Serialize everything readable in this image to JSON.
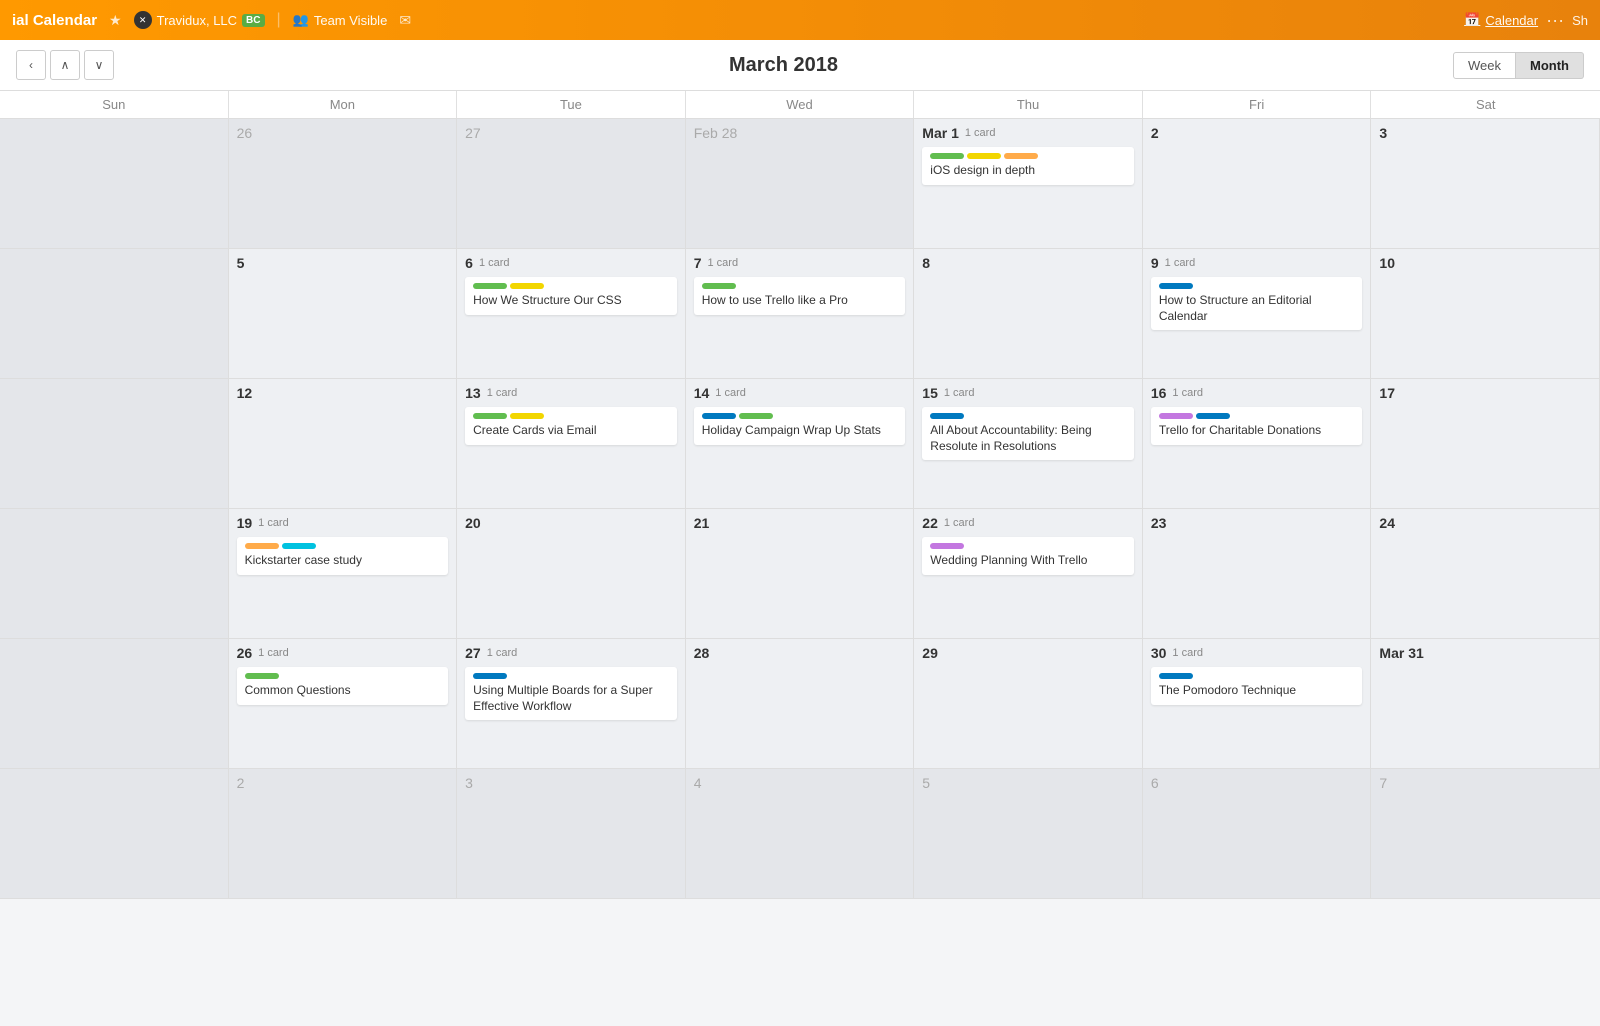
{
  "navbar": {
    "title": "ial Calendar",
    "star": "★",
    "org_name": "Travidux, LLC",
    "org_badge": "BC",
    "team": "Team Visible",
    "calendar_link": "Calendar",
    "dots": "···",
    "sh": "Sh"
  },
  "toolbar": {
    "title": "March 2018",
    "week_label": "Week",
    "month_label": "Month",
    "prev_label": "‹",
    "up_label": "∧",
    "down_label": "∨"
  },
  "days_of_week": [
    "Sun",
    "Mon",
    "Tue",
    "Wed",
    "Thu",
    "Fri",
    "Sat"
  ],
  "weeks": [
    {
      "days": [
        {
          "num": "",
          "label": "",
          "muted": true,
          "out": true
        },
        {
          "num": "26",
          "label": "26",
          "muted": true,
          "out": true,
          "cards": []
        },
        {
          "num": "27",
          "label": "27",
          "muted": true,
          "out": true,
          "cards": []
        },
        {
          "num": "Feb 28",
          "label": "Feb 28",
          "muted": true,
          "out": true,
          "cards": []
        },
        {
          "num": "Mar 1",
          "label": "Mar 1",
          "card_count": "1 card",
          "cards": [
            {
              "labels": [
                "green",
                "yellow",
                "orange"
              ],
              "title": "iOS design in depth"
            }
          ]
        },
        {
          "num": "2",
          "label": "2",
          "cards": []
        },
        {
          "num": "3",
          "label": "3",
          "cards": []
        }
      ]
    },
    {
      "days": [
        {
          "num": "",
          "label": "",
          "muted": true,
          "out": true,
          "cards": []
        },
        {
          "num": "5",
          "label": "5",
          "cards": []
        },
        {
          "num": "6",
          "label": "6",
          "card_count": "1 card",
          "cards": [
            {
              "labels": [
                "green",
                "yellow"
              ],
              "title": "How We Structure Our CSS"
            }
          ]
        },
        {
          "num": "7",
          "label": "7",
          "card_count": "1 card",
          "cards": [
            {
              "labels": [
                "green"
              ],
              "title": "How to use Trello like a Pro"
            }
          ]
        },
        {
          "num": "8",
          "label": "8",
          "cards": []
        },
        {
          "num": "9",
          "label": "9",
          "card_count": "1 card",
          "cards": [
            {
              "labels": [
                "blue"
              ],
              "title": "How to Structure an Editorial Calendar"
            }
          ]
        },
        {
          "num": "10",
          "label": "10",
          "cards": []
        }
      ]
    },
    {
      "days": [
        {
          "num": "",
          "label": "",
          "muted": true,
          "out": true,
          "cards": []
        },
        {
          "num": "12",
          "label": "12",
          "cards": []
        },
        {
          "num": "13",
          "label": "13",
          "card_count": "1 card",
          "cards": [
            {
              "labels": [
                "green",
                "yellow"
              ],
              "title": "Create Cards via Email"
            }
          ]
        },
        {
          "num": "14",
          "label": "14",
          "card_count": "1 card",
          "cards": [
            {
              "labels": [
                "blue",
                "green"
              ],
              "title": "Holiday Campaign Wrap Up Stats"
            }
          ]
        },
        {
          "num": "15",
          "label": "15",
          "card_count": "1 card",
          "cards": [
            {
              "labels": [
                "blue"
              ],
              "title": "All About Accountability: Being Resolute in Resolutions"
            }
          ]
        },
        {
          "num": "16",
          "label": "16",
          "card_count": "1 card",
          "cards": [
            {
              "labels": [
                "purple",
                "blue"
              ],
              "title": "Trello for Charitable Donations"
            }
          ]
        },
        {
          "num": "17",
          "label": "17",
          "cards": []
        }
      ]
    },
    {
      "days": [
        {
          "num": "",
          "label": "",
          "muted": true,
          "out": true,
          "cards": []
        },
        {
          "num": "19",
          "label": "19",
          "card_count": "1 card",
          "cards": [
            {
              "labels": [
                "orange",
                "cyan"
              ],
              "title": "Kickstarter case study"
            }
          ]
        },
        {
          "num": "20",
          "label": "20",
          "cards": []
        },
        {
          "num": "21",
          "label": "21",
          "cards": []
        },
        {
          "num": "22",
          "label": "22",
          "card_count": "1 card",
          "cards": [
            {
              "labels": [
                "purple"
              ],
              "title": "Wedding Planning With Trello"
            }
          ]
        },
        {
          "num": "23",
          "label": "23",
          "cards": []
        },
        {
          "num": "24",
          "label": "24",
          "cards": []
        }
      ]
    },
    {
      "days": [
        {
          "num": "",
          "label": "",
          "muted": true,
          "out": true,
          "cards": []
        },
        {
          "num": "26",
          "label": "26",
          "card_count": "1 card",
          "cards": [
            {
              "labels": [
                "green"
              ],
              "title": "Common Questions"
            }
          ]
        },
        {
          "num": "27",
          "label": "27",
          "card_count": "1 card",
          "cards": [
            {
              "labels": [
                "blue"
              ],
              "title": "Using Multiple Boards for a Super Effective Workflow"
            }
          ]
        },
        {
          "num": "28",
          "label": "28",
          "cards": []
        },
        {
          "num": "29",
          "label": "29",
          "cards": []
        },
        {
          "num": "30",
          "label": "30",
          "card_count": "1 card",
          "cards": [
            {
              "labels": [
                "blue"
              ],
              "title": "The Pomodoro Technique"
            }
          ]
        },
        {
          "num": "Mar 31",
          "label": "Mar 31",
          "cards": []
        }
      ]
    },
    {
      "days": [
        {
          "num": "",
          "label": "",
          "muted": true,
          "out": true,
          "cards": []
        },
        {
          "num": "2",
          "label": "2",
          "muted": true,
          "out": true,
          "cards": []
        },
        {
          "num": "3",
          "label": "3",
          "muted": true,
          "out": true,
          "cards": []
        },
        {
          "num": "4",
          "label": "4",
          "muted": true,
          "out": true,
          "cards": []
        },
        {
          "num": "5",
          "label": "5",
          "muted": true,
          "out": true,
          "cards": []
        },
        {
          "num": "6",
          "label": "6",
          "muted": true,
          "out": true,
          "cards": []
        },
        {
          "num": "7",
          "label": "7",
          "muted": true,
          "out": true,
          "cards": []
        }
      ]
    }
  ]
}
